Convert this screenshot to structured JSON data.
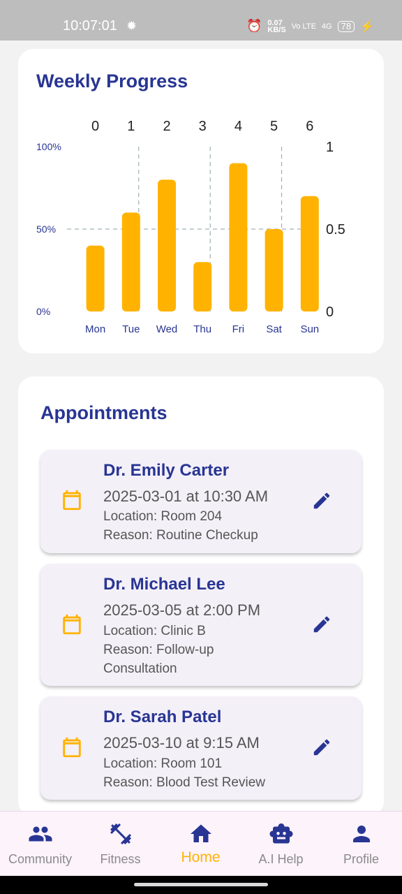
{
  "status_bar": {
    "time": "10:07:01",
    "speed_value": "0.07",
    "speed_unit": "KB/S",
    "network": "Vo LTE",
    "signal": "4G",
    "battery": "78"
  },
  "weekly_progress": {
    "title": "Weekly Progress"
  },
  "chart_data": {
    "type": "bar",
    "categories": [
      "Mon",
      "Tue",
      "Wed",
      "Thu",
      "Fri",
      "Sat",
      "Sun"
    ],
    "values": [
      0.4,
      0.6,
      0.8,
      0.3,
      0.9,
      0.5,
      0.7
    ],
    "top_ticks": [
      "0",
      "1",
      "2",
      "3",
      "4",
      "5",
      "6"
    ],
    "left_ticks": [
      "0%",
      "50%",
      "100%"
    ],
    "right_ticks": [
      "0",
      "0.5",
      "1"
    ],
    "ylim": [
      0,
      1
    ],
    "bar_color": "#ffb300",
    "grid": true
  },
  "appointments": {
    "title": "Appointments",
    "items": [
      {
        "doctor": "Dr. Emily Carter",
        "when": "2025-03-01 at 10:30 AM",
        "location": "Location: Room 204",
        "reason": "Reason: Routine Checkup"
      },
      {
        "doctor": "Dr. Michael Lee",
        "when": "2025-03-05 at 2:00 PM",
        "location": "Location: Clinic B",
        "reason": "Reason: Follow-up Consultation"
      },
      {
        "doctor": "Dr. Sarah Patel",
        "when": "2025-03-10 at 9:15 AM",
        "location": "Location: Room 101",
        "reason": "Reason: Blood Test Review"
      }
    ]
  },
  "bottom_nav": {
    "active": "Home",
    "items": [
      {
        "label": "Community",
        "icon": "people-icon"
      },
      {
        "label": "Fitness",
        "icon": "dumbbell-icon"
      },
      {
        "label": "Home",
        "icon": "home-icon"
      },
      {
        "label": "A.I Help",
        "icon": "robot-icon"
      },
      {
        "label": "Profile",
        "icon": "person-icon"
      }
    ]
  },
  "colors": {
    "accent": "#ffb300",
    "primary": "#283593"
  }
}
